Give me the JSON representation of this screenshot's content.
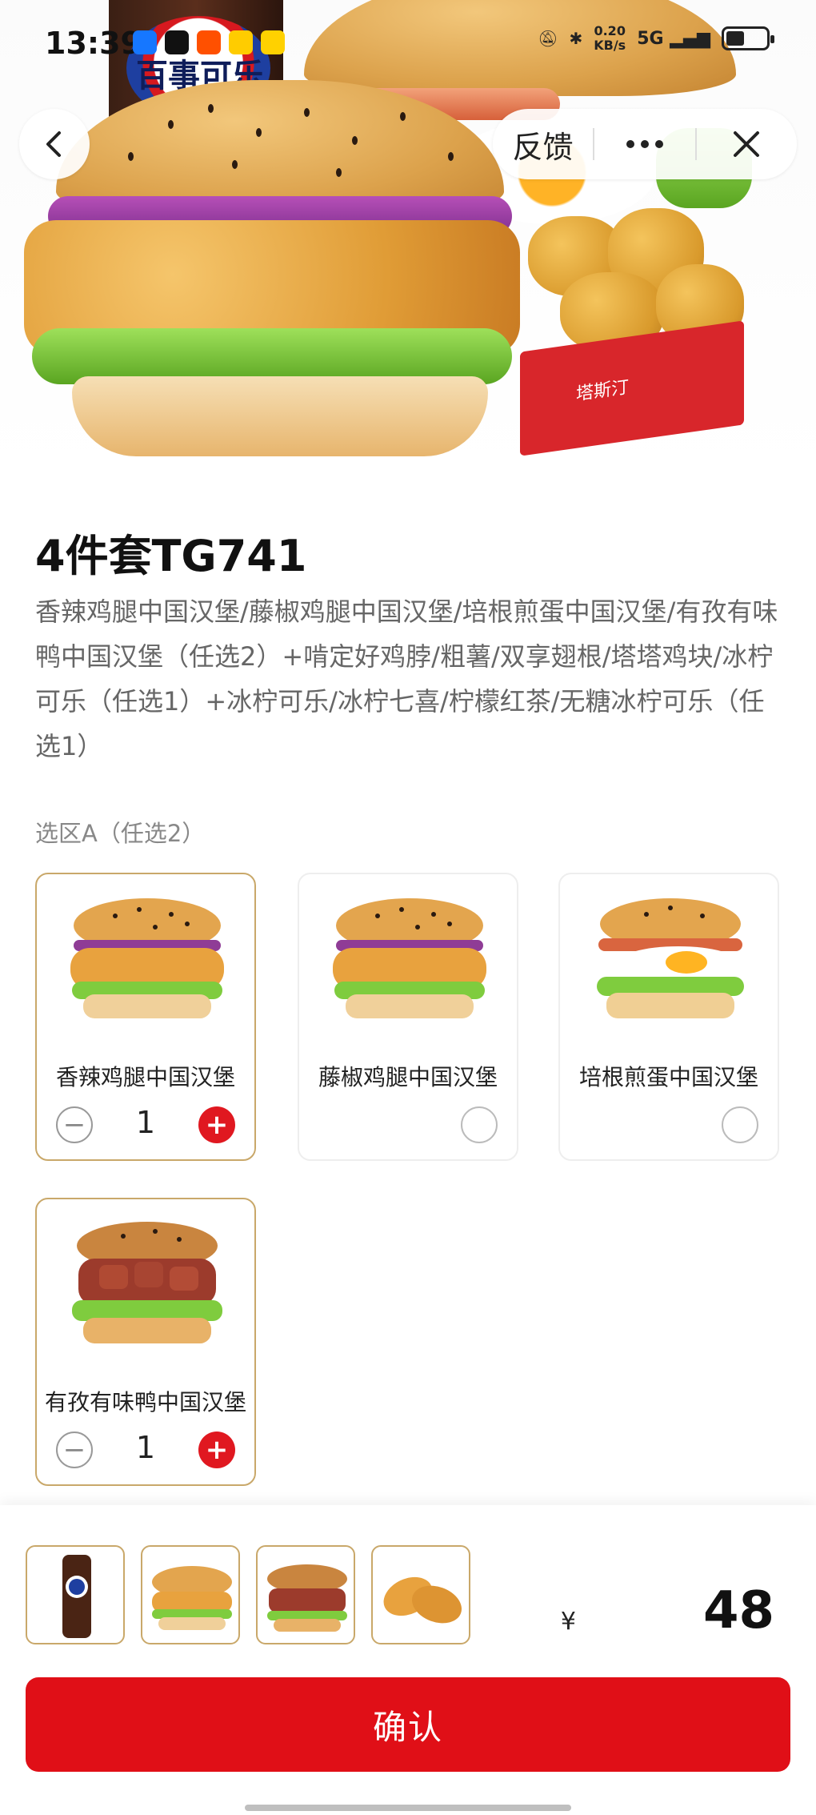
{
  "status_bar": {
    "time": "13:39",
    "network_speed": "0.20",
    "network_unit": "KB/s",
    "signal": "5G",
    "app_icons": [
      "alipay-icon",
      "qq-icon",
      "taobao-icon",
      "ele-icon",
      "meituan-icon"
    ]
  },
  "top_nav": {
    "back_icon": "chevron-left-icon",
    "feedback_label": "反馈",
    "more_icon": "more-dots-icon",
    "close_icon": "close-icon"
  },
  "hero": {
    "cola_brand": "百事可乐",
    "box_brand": "塔斯汀"
  },
  "product": {
    "title": "4件套TG741",
    "description": "香辣鸡腿中国汉堡/藤椒鸡腿中国汉堡/培根煎蛋中国汉堡/有孜有味鸭中国汉堡（任选2）+啃定好鸡脖/粗薯/双享翅根/塔塔鸡块/冰柠可乐（任选1）+冰柠可乐/冰柠七喜/柠檬红茶/无糖冰柠可乐（任选1）"
  },
  "section_a": {
    "label": "选区A（任选2）",
    "items": [
      {
        "name": "香辣鸡腿中国汉堡",
        "selected": true,
        "qty": "1"
      },
      {
        "name": "藤椒鸡腿中国汉堡",
        "selected": false
      },
      {
        "name": "培根煎蛋中国汉堡",
        "selected": false
      },
      {
        "name": "有孜有味鸭中国汉堡",
        "selected": true,
        "qty": "1"
      }
    ]
  },
  "bottom_bar": {
    "thumbnails": [
      "cola-thumbnail",
      "spicy-chicken-burger-thumbnail",
      "duck-burger-thumbnail",
      "chicken-wings-thumbnail"
    ],
    "price_symbol": "¥",
    "price": "48",
    "confirm_label": "确认"
  },
  "colors": {
    "accent_red": "#e00f17",
    "selected_border": "#c9a86a",
    "plus_button": "#e01820"
  }
}
